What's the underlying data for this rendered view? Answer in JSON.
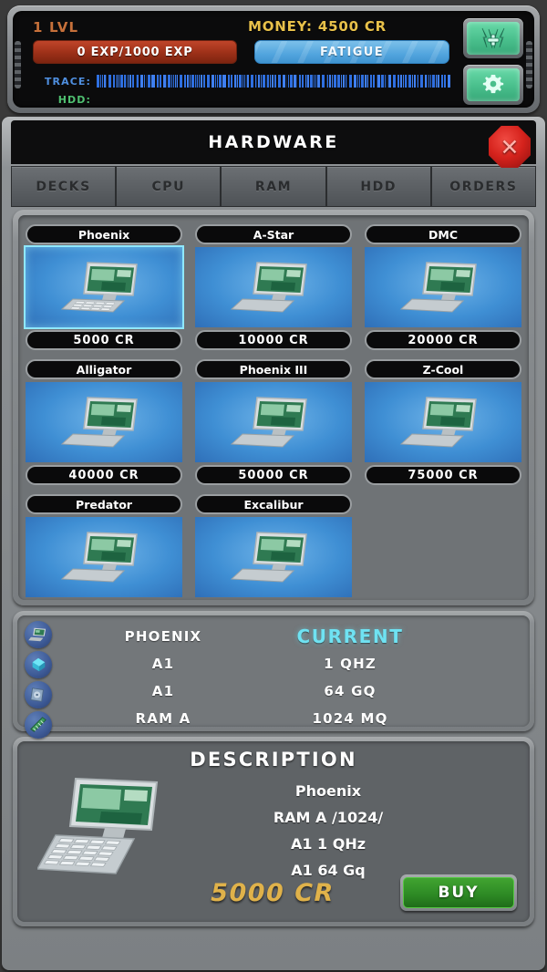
{
  "status": {
    "level_text": "1 LVL",
    "money_text": "MONEY: 4500 CR",
    "exp_text": "0 EXP/1000 EXP",
    "fatigue_text": "FATIGUE",
    "trace_label": "TRACE:",
    "hdd_label": "HDD:",
    "heal_icon": "heal-lightning-icon",
    "settings_icon": "gear-icon",
    "colors": {
      "level": "#c6703a",
      "money": "#e8c14a",
      "exp_bar": "#9c3018",
      "fatigue_bar": "#52a5de",
      "trace": "#4f8fe0",
      "hdd": "#4fc070"
    }
  },
  "window": {
    "title": "HARDWARE",
    "close_icon": "close-x-icon"
  },
  "tabs": [
    {
      "label": "DECKS",
      "active": true
    },
    {
      "label": "CPU",
      "active": false
    },
    {
      "label": "RAM",
      "active": false
    },
    {
      "label": "HDD",
      "active": false
    },
    {
      "label": "ORDERS",
      "active": false
    }
  ],
  "grid": {
    "items": [
      {
        "name": "Phoenix",
        "price": "5000 CR",
        "selected": true
      },
      {
        "name": "A-Star",
        "price": "10000 CR",
        "selected": false
      },
      {
        "name": "DMC",
        "price": "20000 CR",
        "selected": false
      },
      {
        "name": "Alligator",
        "price": "40000 CR",
        "selected": false
      },
      {
        "name": "Phoenix III",
        "price": "50000 CR",
        "selected": false
      },
      {
        "name": "Z-Cool",
        "price": "75000 CR",
        "selected": false
      },
      {
        "name": "Predator",
        "price": "",
        "selected": false
      },
      {
        "name": "Excalibur",
        "price": "",
        "selected": false
      }
    ]
  },
  "stats": {
    "rows": [
      {
        "icon": "laptop-icon",
        "left": "PHOENIX",
        "right": "CURRENT",
        "highlight": true
      },
      {
        "icon": "cpu-chip-icon",
        "left": "A1",
        "right": "1 QHZ",
        "highlight": false
      },
      {
        "icon": "hdd-icon",
        "left": "A1",
        "right": "64 GQ",
        "highlight": false
      },
      {
        "icon": "ram-stick-icon",
        "left": "RAM A",
        "right": "1024 MQ",
        "highlight": false
      }
    ]
  },
  "description": {
    "title": "DESCRIPTION",
    "lines": [
      "Phoenix",
      "RAM A /1024/",
      "A1 1 QHz",
      "A1 64 Gq"
    ],
    "price": "5000 CR",
    "buy_label": "BUY",
    "laptop_icon": "laptop-icon",
    "price_color": "#e0b24a",
    "buy_color": "#2e8b25"
  }
}
